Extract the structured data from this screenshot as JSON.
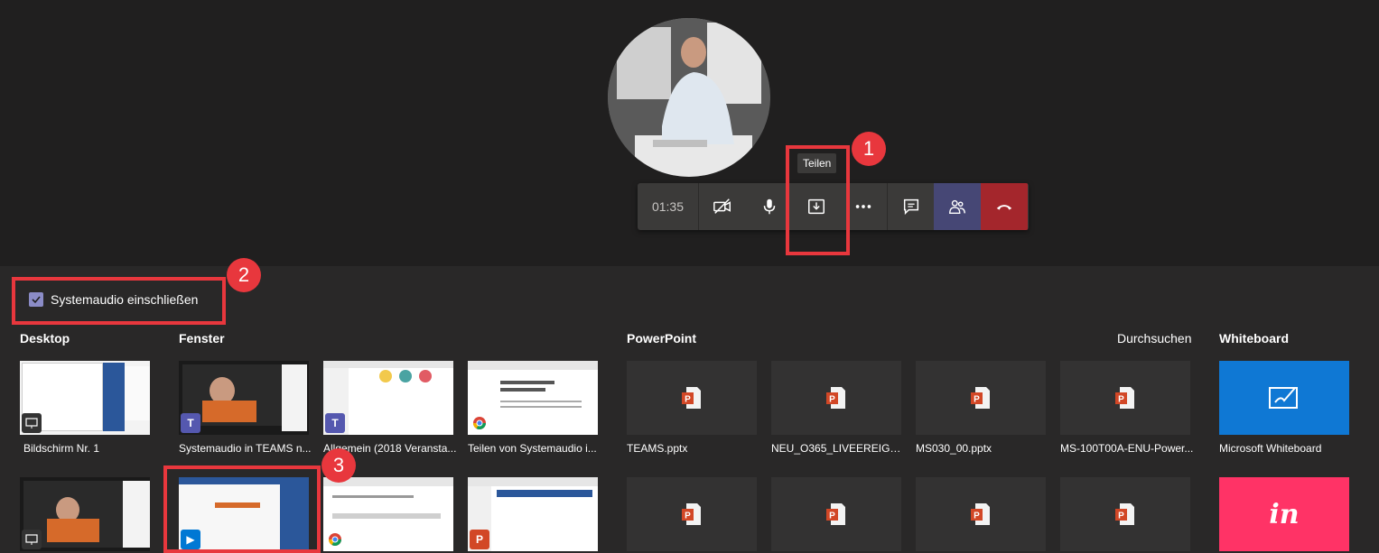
{
  "call": {
    "timer": "01:35",
    "tooltip": "Teilen"
  },
  "annotations": {
    "badge1": "1",
    "badge2": "2",
    "badge3": "3"
  },
  "share": {
    "system_audio_label": "Systemaudio einschließen",
    "sections": {
      "desktop": "Desktop",
      "fenster": "Fenster",
      "powerpoint": "PowerPoint",
      "browse": "Durchsuchen",
      "whiteboard": "Whiteboard"
    },
    "desktop_items": [
      "Bildschirm Nr. 1"
    ],
    "window_items": [
      "Systemaudio in TEAMS n...",
      "Allgemein (2018 Veransta...",
      "Teilen von Systemaudio i..."
    ],
    "ppt_items": [
      "TEAMS.pptx",
      "NEU_O365_LIVEEREIGNIS...",
      "MS030_00.pptx",
      "MS-100T00A-ENU-Power..."
    ],
    "whiteboard_items": [
      "Microsoft Whiteboard"
    ],
    "invision_logo": "in"
  },
  "colors": {
    "accent_red": "#e8373d",
    "people_button": "#464775",
    "hangup": "#a4262c",
    "whiteboard_blue": "#0f78d4",
    "invision_pink": "#ff3366"
  }
}
